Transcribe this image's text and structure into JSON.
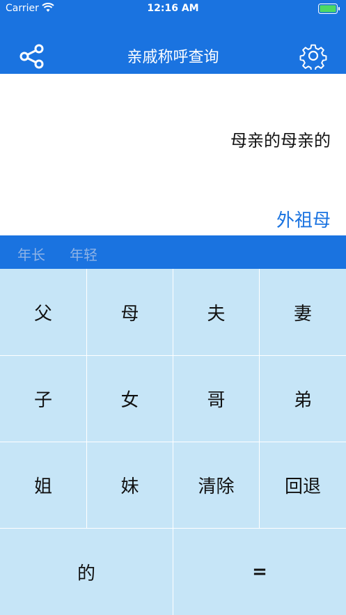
{
  "status": {
    "carrier": "Carrier",
    "time": "12:16 AM"
  },
  "nav": {
    "title": "亲戚称呼查询",
    "left_icon": "share-icon",
    "right_icon": "gear-icon"
  },
  "display": {
    "expression": "母亲的母亲的",
    "result": "外祖母"
  },
  "toggles": {
    "older": "年长",
    "younger": "年轻"
  },
  "keys": {
    "father": "父",
    "mother": "母",
    "husband": "夫",
    "wife": "妻",
    "son": "子",
    "daughter": "女",
    "elder_brother": "哥",
    "younger_brother": "弟",
    "elder_sister": "姐",
    "younger_sister": "妹",
    "clear": "清除",
    "back": "回退",
    "of": "的",
    "equals": "="
  },
  "colors": {
    "primary": "#1a73e0",
    "keypad_bg": "#c6e5f7",
    "toggle_inactive": "#8fb3e6"
  }
}
